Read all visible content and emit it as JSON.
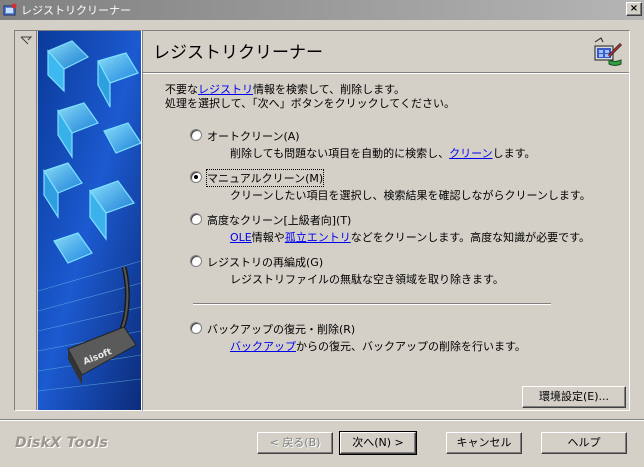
{
  "window": {
    "title": "レジストリクリーナー",
    "close_label": "×"
  },
  "header": {
    "title": "レジストリクリーナー"
  },
  "intro": {
    "line1_before": "不要な",
    "line1_link": "レジストリ",
    "line1_after": "情報を検索して、削除します。",
    "line2": "処理を選択して、「次へ」ボタンをクリックしてください。"
  },
  "options": [
    {
      "label": "オートクリーン(A)",
      "checked": false,
      "desc_before": "削除しても問題ない項目を自動的に検索し、",
      "desc_link": "クリーン",
      "desc_after": "します。"
    },
    {
      "label": "マニュアルクリーン(M)",
      "checked": true,
      "desc": "クリーンしたい項目を選択し、検索結果を確認しながらクリーンします。"
    },
    {
      "label": "高度なクリーン[上級者向](T)",
      "checked": false,
      "desc_link1": "OLE",
      "desc_mid": "情報や",
      "desc_link2": "孤立エントリ",
      "desc_after": "などをクリーンします。高度な知識が必要です。"
    },
    {
      "label": "レジストリの再編成(G)",
      "checked": false,
      "desc": "レジストリファイルの無駄な空き領域を取り除きます。"
    },
    {
      "label": "バックアップの復元・削除(R)",
      "checked": false,
      "desc_link": "バックアップ",
      "desc_after": "からの復元、バックアップの削除を行います。"
    }
  ],
  "buttons": {
    "settings": "環境設定(E)...",
    "back": "< 戻る(B)",
    "next": "次へ(N) >",
    "cancel": "キャンセル",
    "help": "ヘルプ"
  },
  "brand": "DiskX Tools",
  "side_image": {
    "logo_text": "Aisoft"
  }
}
